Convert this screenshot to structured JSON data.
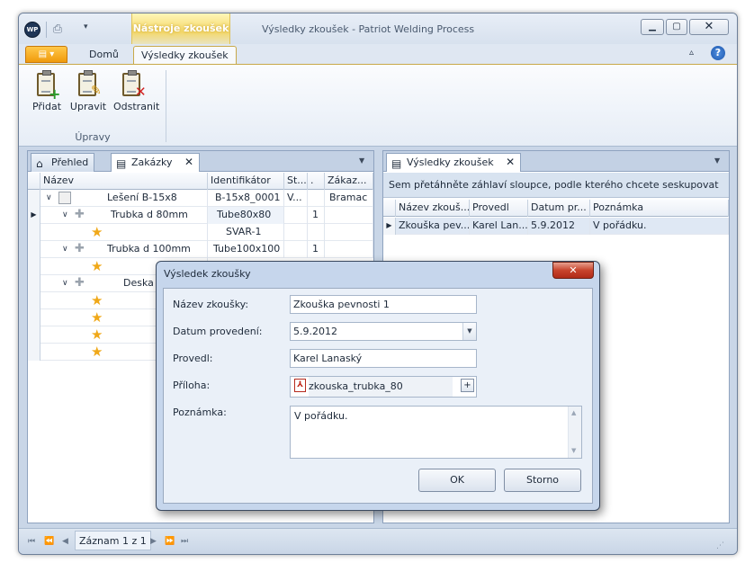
{
  "window": {
    "title": "Výsledky zkoušek - Patriot Welding Process",
    "app_logo": "WP",
    "context_tab": "Nástroje zkoušek",
    "icons": {
      "print": "print-icon",
      "close": "close-icon",
      "help": "help-icon"
    }
  },
  "ribbon": {
    "tabs": {
      "home": "Domů",
      "active": "Výsledky zkoušek"
    },
    "buttons": {
      "add": "Přidat",
      "edit": "Upravit",
      "remove": "Odstranit"
    },
    "group_label": "Úpravy"
  },
  "left_pane": {
    "tabs": {
      "overview": "Přehled",
      "orders": "Zakázky"
    },
    "columns": [
      "Název",
      "Identifikátor",
      "St...",
      ".",
      "Zákaz..."
    ],
    "rows": [
      {
        "name": "Lešení B-15x8",
        "id": "B-15x8_0001",
        "st": "V...",
        "n": "",
        "order": "Bramac"
      },
      {
        "name": "Trubka d 80mm",
        "id": "Tube80x80",
        "st": "",
        "n": "1",
        "order": ""
      },
      {
        "name": "",
        "id": "SVAR-1",
        "st": "",
        "n": "",
        "order": ""
      },
      {
        "name": "Trubka d 100mm",
        "id": "Tube100x100",
        "st": "",
        "n": "1",
        "order": ""
      },
      {
        "name": "",
        "id": "",
        "st": "",
        "n": "",
        "order": ""
      },
      {
        "name": "Deska s",
        "id": "",
        "st": "",
        "n": "",
        "order": ""
      }
    ]
  },
  "right_pane": {
    "tab": "Výsledky zkoušek",
    "group_hint": "Sem přetáhněte záhlaví sloupce, podle kterého chcete seskupovat",
    "columns": [
      "Název zkouš...",
      "Provedl",
      "Datum pr...",
      "Poznámka"
    ],
    "rows": [
      {
        "name": "Zkouška pev...",
        "by": "Karel Lan...",
        "date": "5.9.2012",
        "note": "V pořádku."
      }
    ]
  },
  "status": {
    "record": "Záznam 1 z 1"
  },
  "dialog": {
    "title": "Výsledek zkoušky",
    "labels": {
      "name": "Název zkoušky:",
      "date": "Datum provedení:",
      "by": "Provedl:",
      "attachment": "Příloha:",
      "note": "Poznámka:"
    },
    "values": {
      "name": "Zkouška pevnosti 1",
      "date": "5.9.2012",
      "by": "Karel Lanaský",
      "attachment": "zkouska_trubka_80",
      "note": "V pořádku."
    },
    "buttons": {
      "ok": "OK",
      "cancel": "Storno"
    }
  }
}
